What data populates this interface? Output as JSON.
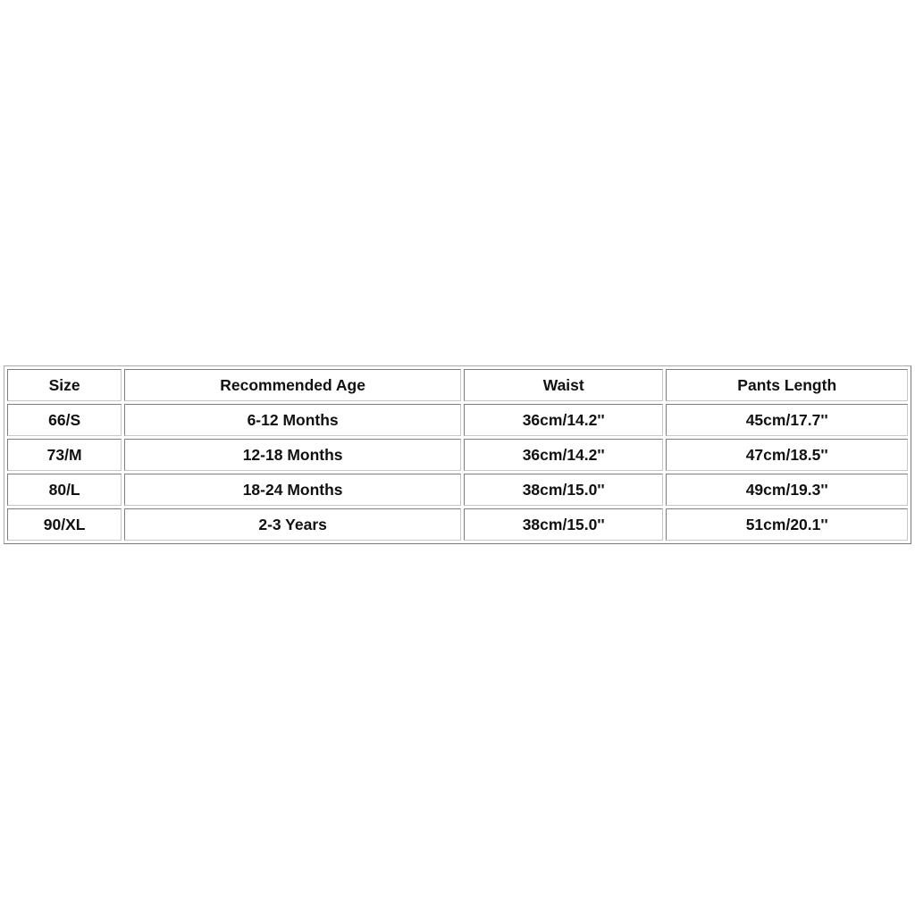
{
  "size_chart": {
    "headers": [
      "Size",
      "Recommended Age",
      "Waist",
      "Pants Length"
    ],
    "rows": [
      [
        "66/S",
        "6-12 Months",
        "36cm/14.2''",
        "45cm/17.7''"
      ],
      [
        "73/M",
        "12-18 Months",
        "36cm/14.2''",
        "47cm/18.5''"
      ],
      [
        "80/L",
        "18-24 Months",
        "38cm/15.0''",
        "49cm/19.3''"
      ],
      [
        "90/XL",
        "2-3 Years",
        "38cm/15.0''",
        "51cm/20.1''"
      ]
    ]
  }
}
